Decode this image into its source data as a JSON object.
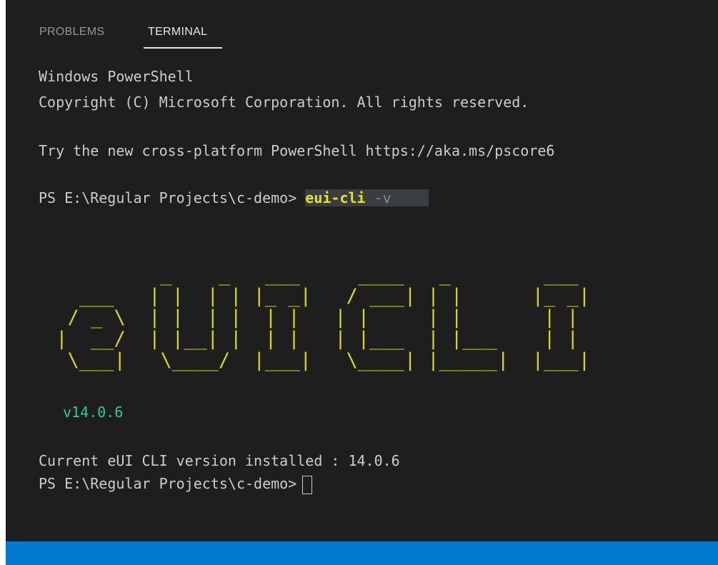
{
  "tabs": {
    "problems": "PROBLEMS",
    "terminal": "TERMINAL"
  },
  "terminal": {
    "line1": "Windows PowerShell",
    "line2": "Copyright (C) Microsoft Corporation. All rights reserved.",
    "line3": "Try the new cross-platform PowerShell https://aka.ms/pscore6",
    "prompt": "PS E:\\Regular Projects\\c-demo> ",
    "command_name": "eui-cli",
    "command_arg": " -v",
    "banner_art": "          _    _   ___     ____   _        ___\n   ___   | |  | | |_ _|   / ___| | |      |_ _|\n  / _ \\  | |  | |  | |   | |     | |       | |\n |  __/  | |__| |  | |   | |___  | |___    | |\n  \\___|   \\____/  |___|   \\____| |_____|  |___|",
    "banner_version": "v14.0.6",
    "installed_line": "Current eUI CLI version installed : 14.0.6",
    "final_prompt": "PS E:\\Regular Projects\\c-demo>"
  },
  "colors": {
    "background": "#1e1e1e",
    "text": "#cccccc",
    "command": "#e5e510",
    "banner": "#d5d51a",
    "version": "#23d18b",
    "statusbar": "#007acc"
  }
}
